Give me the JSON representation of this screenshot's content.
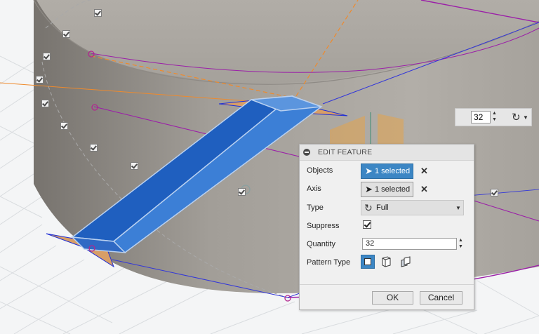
{
  "viewport": {
    "hud": {
      "quantity": "32"
    }
  },
  "dialog": {
    "title": "EDIT FEATURE",
    "fields": {
      "objects_label": "Objects",
      "objects_value": "1 selected",
      "axis_label": "Axis",
      "axis_value": "1 selected",
      "type_label": "Type",
      "type_value": "Full",
      "suppress_label": "Suppress",
      "suppress_checked": true,
      "quantity_label": "Quantity",
      "quantity_value": "32",
      "pattern_type_label": "Pattern Type"
    },
    "buttons": {
      "ok": "OK",
      "cancel": "Cancel"
    }
  },
  "colors": {
    "selection_blue": "#3c86c4",
    "body_gray": "#a7a49f",
    "sketch_magenta": "#9b1fa8",
    "axis_orange": "#ef8a2c",
    "edge_blue": "#1f2fd6"
  },
  "icons": {
    "objects": "cursor-icon",
    "axis": "cursor-icon",
    "type": "circular-arrow-icon",
    "hud_pattern": "circular-arrow-icon",
    "pattern_types": [
      "faces-icon",
      "bodies-icon",
      "features-icon"
    ],
    "clear": "close-icon"
  }
}
